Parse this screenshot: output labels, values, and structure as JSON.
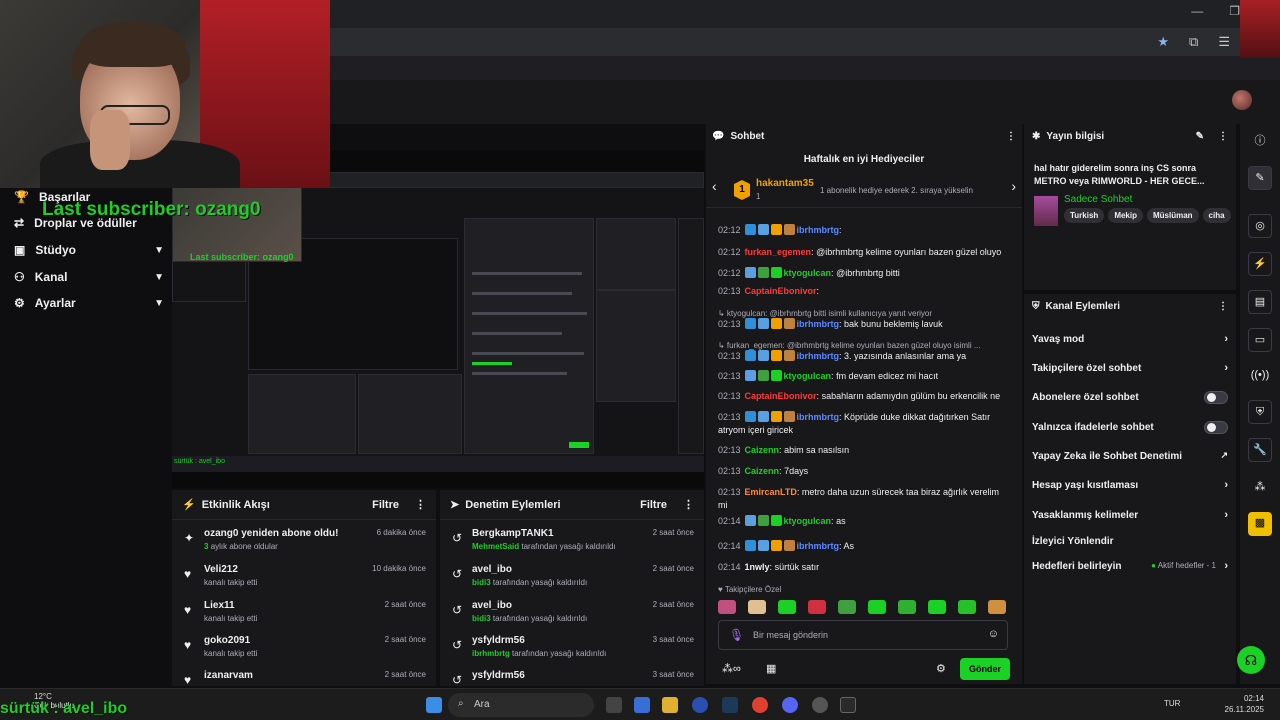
{
  "overlay": {
    "last_subscriber": "Last subscriber: ozang0",
    "bottom_user": "sürtük : avel_ibo",
    "preview_bottom_user": "sürtük : avel_ibo",
    "preview_last_subscriber": "Last subscriber: ozang0"
  },
  "weather": {
    "temp": "12°C",
    "desc": "Çok bulutlu"
  },
  "left_nav": {
    "items": [
      {
        "label": "Başarılar",
        "icon": "trophy-icon",
        "chevron": false
      },
      {
        "label": "Droplar ve ödüller",
        "icon": "gift-icon",
        "chevron": false
      },
      {
        "label": "Stüdyo",
        "icon": "video-icon",
        "chevron": true
      },
      {
        "label": "Kanal",
        "icon": "people-icon",
        "chevron": true
      },
      {
        "label": "Ayarlar",
        "icon": "gear-icon",
        "chevron": true
      }
    ]
  },
  "activity": {
    "title": "Etkinlik Akışı",
    "filter": "Filtre",
    "items": [
      {
        "name": "ozang0 yeniden abone oldu!",
        "detail_bold": "3",
        "detail": "aylık abone oldular",
        "time": "6 dakika önce",
        "icon": "sparkle-icon"
      },
      {
        "name": "Veli212",
        "detail_bold": "",
        "detail": "kanalı takip etti",
        "time": "10 dakika önce",
        "icon": "heart-icon"
      },
      {
        "name": "Liex11",
        "detail_bold": "",
        "detail": "kanalı takip etti",
        "time": "2 saat önce",
        "icon": "heart-icon"
      },
      {
        "name": "goko2091",
        "detail_bold": "",
        "detail": "kanalı takip etti",
        "time": "2 saat önce",
        "icon": "heart-icon"
      },
      {
        "name": "izanarvam",
        "detail_bold": "",
        "detail": "",
        "time": "2 saat önce",
        "icon": "heart-icon"
      }
    ]
  },
  "moderation": {
    "title": "Denetim Eylemleri",
    "filter": "Filtre",
    "items": [
      {
        "name": "BergkampTANK1",
        "detail_bold": "MehmetSaid",
        "detail": "tarafından yasağı kaldırıldı",
        "time": "2 saat önce"
      },
      {
        "name": "avel_ibo",
        "detail_bold": "bidi3",
        "detail": "tarafından yasağı kaldırıldı",
        "time": "2 saat önce"
      },
      {
        "name": "avel_ibo",
        "detail_bold": "bidi3",
        "detail": "tarafından yasağı kaldırıldı",
        "time": "2 saat önce"
      },
      {
        "name": "ysfyldrm56",
        "detail_bold": "ibrhmbrtg",
        "detail": "tarafından yasağı kaldırıldı",
        "time": "3 saat önce"
      },
      {
        "name": "ysfyldrm56",
        "detail_bold": "",
        "detail": "",
        "time": "3 saat önce"
      }
    ]
  },
  "chat": {
    "title": "Sohbet",
    "gift_title": "Haftalık en iyi Hediyeciler",
    "gift_rank": "1",
    "gift_user": "hakantam35",
    "gift_count": "1",
    "gift_desc": "1 abonelik hediye ederek 2. sıraya yükselin",
    "messages": [
      {
        "time": "02:12",
        "user": "ibrhmbrtg",
        "color": "#5c8bff",
        "text": "",
        "reply": false,
        "badges": [
          "#2f8fd8",
          "#5aa0e0",
          "#f0a000",
          "#c08040"
        ]
      },
      {
        "time": "02:12",
        "user": "furkan_egemen",
        "color": "#ff3b3b",
        "text": "@ibrhmbrtg kelime oyunları bazen güzel oluyo",
        "reply": false,
        "badges": []
      },
      {
        "time": "02:12",
        "user": "ktyogulcan",
        "color": "#1bd126",
        "text": "@ibrhmbrtg bitti",
        "reply": false,
        "badges": [
          "#5aa0e0",
          "#40a040",
          "#1bd126"
        ]
      },
      {
        "time": "02:13",
        "user": "CaptainEbonivor",
        "color": "#ff3b3b",
        "text": "",
        "reply": false,
        "badges": []
      },
      {
        "time": "",
        "user": "",
        "color": "#adadb8",
        "text": "↳ ktyogulcan: @ibrhmbrtg bitti isimli kullanıcıya yanıt veriyor",
        "reply": true,
        "badges": []
      },
      {
        "time": "02:13",
        "user": "ibrhmbrtg",
        "color": "#5c8bff",
        "text": "bak bunu beklemiş lavuk",
        "reply": false,
        "badges": [
          "#2f8fd8",
          "#5aa0e0",
          "#f0a000",
          "#c08040"
        ]
      },
      {
        "time": "",
        "user": "",
        "color": "#adadb8",
        "text": "↳ furkan_egemen: @ibrhmbrtg kelime oyunları bazen güzel oluyo isimli ...",
        "reply": true,
        "badges": []
      },
      {
        "time": "02:13",
        "user": "ibrhmbrtg",
        "color": "#5c8bff",
        "text": "3. yazısında anlasınlar ama ya",
        "reply": false,
        "badges": [
          "#2f8fd8",
          "#5aa0e0",
          "#f0a000",
          "#c08040"
        ]
      },
      {
        "time": "02:13",
        "user": "ktyogulcan",
        "color": "#1bd126",
        "text": "fm devam edicez mi hacıt",
        "reply": false,
        "badges": [
          "#5aa0e0",
          "#40a040",
          "#1bd126"
        ]
      },
      {
        "time": "02:13",
        "user": "CaptainEbonivor",
        "color": "#ff3b3b",
        "text": "sabahların adamıydın gülüm bu erkencilik ne",
        "reply": false,
        "badges": []
      },
      {
        "time": "02:13",
        "user": "ibrhmbrtg",
        "color": "#5c8bff",
        "text": "Köprüde duke dikkat dağıtırken Satır atryom içeri giricek",
        "reply": false,
        "badges": [
          "#2f8fd8",
          "#5aa0e0",
          "#f0a000",
          "#c08040"
        ]
      },
      {
        "time": "02:13",
        "user": "Caizenn",
        "color": "#1bd126",
        "text": "abim sa nasılsın",
        "reply": false,
        "badges": []
      },
      {
        "time": "02:13",
        "user": "Caizenn",
        "color": "#1bd126",
        "text": "7days",
        "reply": false,
        "badges": []
      },
      {
        "time": "02:13",
        "user": "EmircanLTD",
        "color": "#ff8a3b",
        "text": "metro daha uzun sürecek taa biraz ağırlık verelim mi",
        "reply": false,
        "badges": []
      },
      {
        "time": "02:14",
        "user": "ktyogulcan",
        "color": "#1bd126",
        "text": "as",
        "reply": false,
        "badges": [
          "#5aa0e0",
          "#40a040",
          "#1bd126"
        ]
      },
      {
        "time": "02:14",
        "user": "ibrhmbrtg",
        "color": "#5c8bff",
        "text": "As",
        "reply": false,
        "badges": [
          "#2f8fd8",
          "#5aa0e0",
          "#f0a000",
          "#c08040"
        ]
      },
      {
        "time": "02:14",
        "user": "1nwly",
        "color": "#efeff1",
        "text": "sürtük satır",
        "reply": false,
        "badges": []
      }
    ],
    "filter_label": "Takipçilere Özel",
    "input_placeholder": "Bir mesaj gönderin",
    "send_label": "Gönder"
  },
  "stream_info": {
    "title": "Yayın bilgisi",
    "stream_title": "hal hatır giderelim sonra inş CS sonra METRO veya RIMWORLD - HER GECE...",
    "category": "Sadece Sohbet",
    "tags": [
      "Turkish",
      "Mekip",
      "Müslüman",
      "ciha"
    ]
  },
  "channel_actions": {
    "title": "Kanal Eylemleri",
    "items": [
      {
        "label": "Yavaş mod",
        "control": "chevron"
      },
      {
        "label": "Takipçilere özel sohbet",
        "control": "chevron"
      },
      {
        "label": "Abonelere özel sohbet",
        "control": "toggle"
      },
      {
        "label": "Yalnızca ifadelerle sohbet",
        "control": "toggle"
      },
      {
        "label": "Yapay Zeka ile Sohbet Denetimi",
        "control": "external"
      },
      {
        "label": "Hesap yaşı kısıtlaması",
        "control": "chevron"
      },
      {
        "label": "Yasaklanmış kelimeler",
        "control": "chevron"
      },
      {
        "label": "İzleyici Yönlendir",
        "control": "none"
      },
      {
        "label": "Hedefleri belirleyin",
        "control": "chevron",
        "badge": "Aktif hedefler - 1"
      }
    ]
  },
  "taskbar": {
    "search": "Ara",
    "lang": "TUR",
    "time": "02:14",
    "date": "26.11.2025"
  }
}
